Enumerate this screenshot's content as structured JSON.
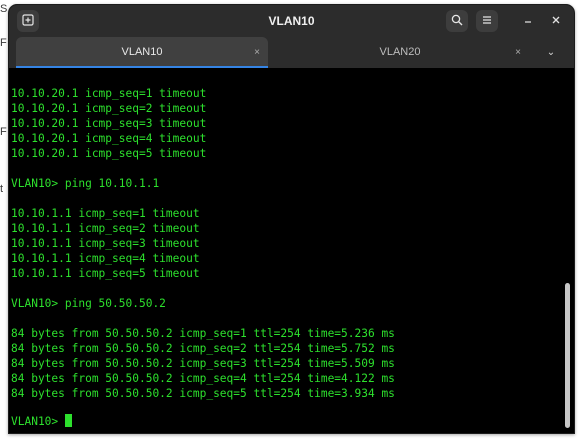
{
  "window": {
    "title": "VLAN10",
    "newtab_icon": "new-tab-icon",
    "search_icon": "search-icon",
    "menu_icon": "hamburger-menu-icon",
    "minimize_icon": "minimize-icon",
    "close_icon": "close-icon"
  },
  "left_glyphs": [
    "S",
    "F",
    "F",
    "t"
  ],
  "tabs": [
    {
      "label": "VLAN10",
      "close_glyph": "×",
      "active": true
    },
    {
      "label": "VLAN20",
      "close_glyph": "×",
      "active": false
    }
  ],
  "tab_menu_glyph": "⌄",
  "terminal": {
    "lines": [
      "10.10.20.1 icmp_seq=1 timeout",
      "10.10.20.1 icmp_seq=2 timeout",
      "10.10.20.1 icmp_seq=3 timeout",
      "10.10.20.1 icmp_seq=4 timeout",
      "10.10.20.1 icmp_seq=5 timeout",
      "",
      "VLAN10> ping 10.10.1.1",
      "",
      "10.10.1.1 icmp_seq=1 timeout",
      "10.10.1.1 icmp_seq=2 timeout",
      "10.10.1.1 icmp_seq=3 timeout",
      "10.10.1.1 icmp_seq=4 timeout",
      "10.10.1.1 icmp_seq=5 timeout",
      "",
      "VLAN10> ping 50.50.50.2",
      "",
      "84 bytes from 50.50.50.2 icmp_seq=1 ttl=254 time=5.236 ms",
      "84 bytes from 50.50.50.2 icmp_seq=2 ttl=254 time=5.752 ms",
      "84 bytes from 50.50.50.2 icmp_seq=3 ttl=254 time=5.509 ms",
      "84 bytes from 50.50.50.2 icmp_seq=4 ttl=254 time=4.122 ms",
      "84 bytes from 50.50.50.2 icmp_seq=5 ttl=254 time=3.934 ms",
      ""
    ],
    "prompt": "VLAN10> ",
    "text_color": "#2de02d"
  },
  "colors": {
    "titlebar": "#2c2c2c",
    "active_tab": "#404040",
    "tab_indicator": "#3584e4",
    "terminal_bg": "#000000"
  }
}
